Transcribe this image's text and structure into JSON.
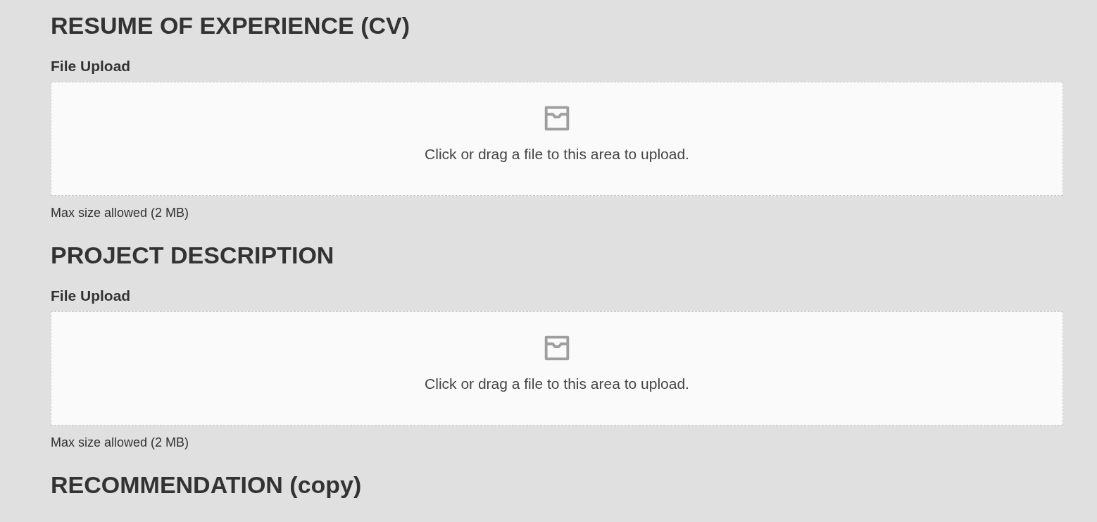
{
  "sections": [
    {
      "heading": "RESUME OF EXPERIENCE (CV)",
      "upload": {
        "label": "File Upload",
        "prompt": "Click or drag a file to this area to upload.",
        "hint": "Max size allowed (2 MB)"
      }
    },
    {
      "heading": "PROJECT DESCRIPTION",
      "upload": {
        "label": "File Upload",
        "prompt": "Click or drag a file to this area to upload.",
        "hint": "Max size allowed (2 MB)"
      }
    },
    {
      "heading": "RECOMMENDATION (copy)"
    }
  ]
}
